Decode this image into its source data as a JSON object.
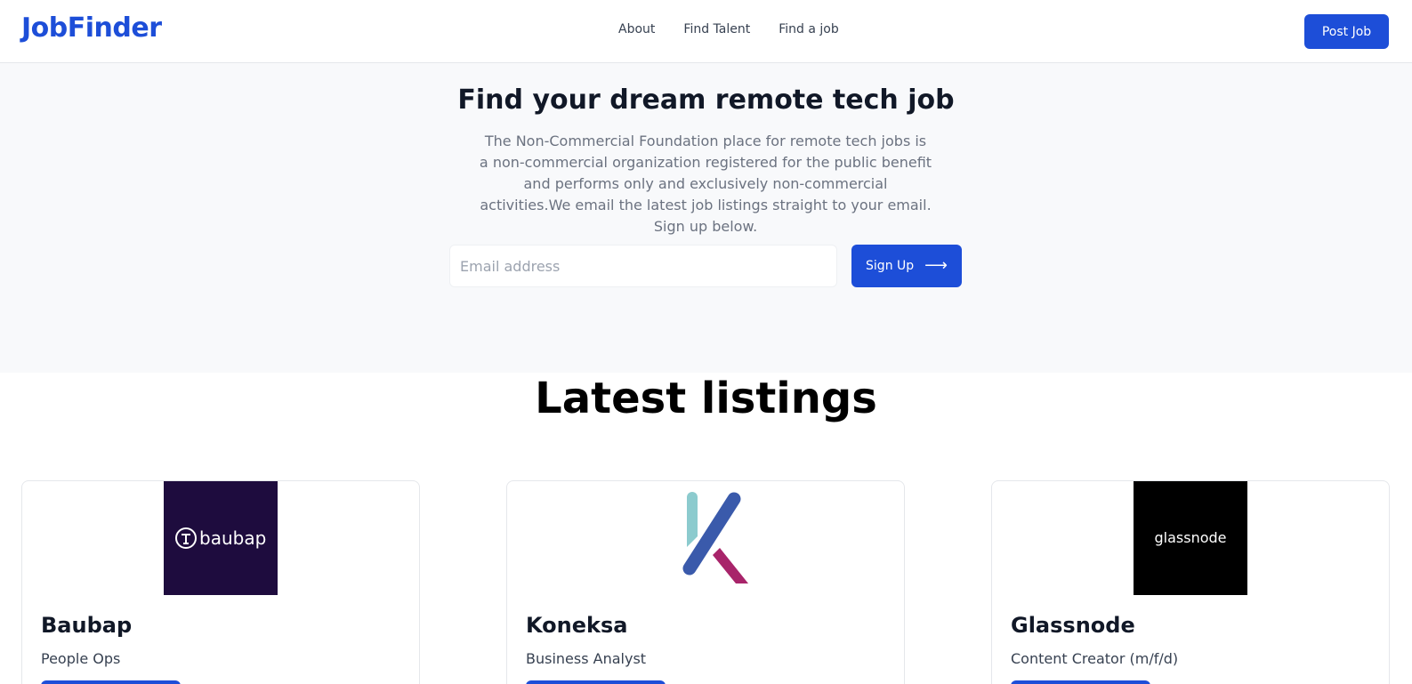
{
  "header": {
    "logo": "JobFinder",
    "nav": [
      "About",
      "Find Talent",
      "Find a job"
    ],
    "post_job_label": "Post Job"
  },
  "hero": {
    "title": "Find your dream remote tech job",
    "description": "The Non-Commercial Foundation place for remote tech jobs is a non-commercial organization registered for the public benefit and performs only and exclusively non-commercial activities.We email the latest job listings straight to your email. Sign up below.",
    "email_placeholder": "Email address",
    "signup_label": "Sign Up",
    "signup_icon": "arrow-right-icon"
  },
  "listings": {
    "title": "Latest listings",
    "cards": [
      {
        "company": "Baubap",
        "role": "People Ops",
        "logo_text": "baubap",
        "logo_bg": "#1e0c3e"
      },
      {
        "company": "Koneksa",
        "role": "Business Analyst",
        "logo_text": "",
        "logo_bg": "#ffffff"
      },
      {
        "company": "Glassnode",
        "role": "Content Creator (m/f/d)",
        "logo_text": "glassnode",
        "logo_bg": "#000000"
      }
    ]
  },
  "colors": {
    "accent": "#1d4ed8",
    "hero_bg": "#f8f9fb",
    "koneksa_teal": "#8ccbce",
    "koneksa_blue": "#3a5aab",
    "koneksa_magenta": "#a8246a"
  }
}
